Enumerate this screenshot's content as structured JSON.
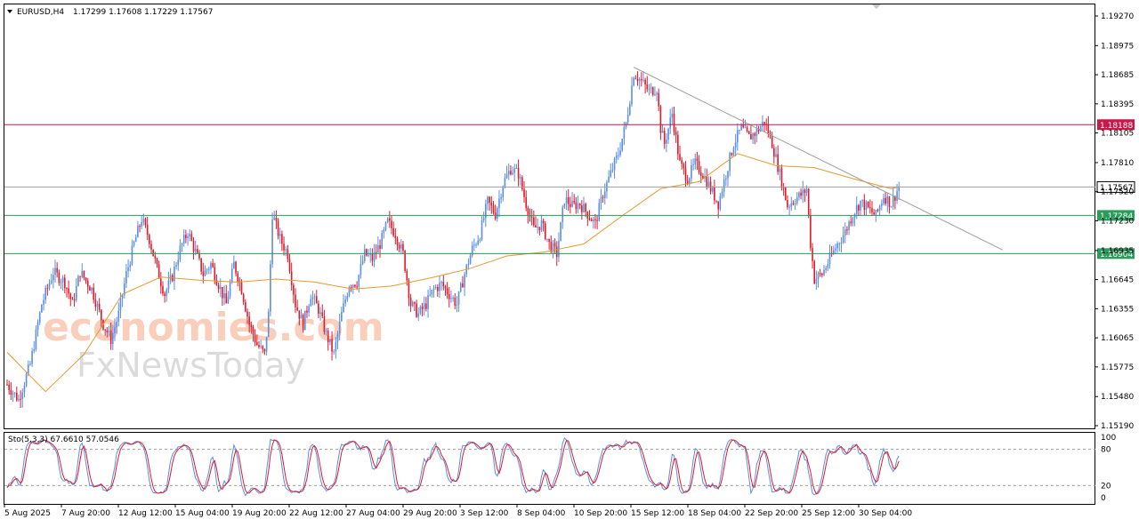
{
  "header": {
    "symbol": "EURUSD,H4",
    "ohlc": "1.17299 1.17608 1.17229 1.17567",
    "collapse_icon": "triangle-down-icon"
  },
  "watermark": {
    "line1": "economies.com",
    "line2": "FxNewsToday"
  },
  "colors": {
    "bull": "#5b8ee6",
    "bear": "#e01a2a",
    "ma": "#e39a2d",
    "resistance": "#c9184a",
    "support": "#2a9d5c",
    "current": "#9e9e9e",
    "trendline": "#9e9e9e",
    "stoch_main": "#5b8ee6",
    "stoch_signal": "#e01a2a"
  },
  "chart_data": [
    {
      "type": "candlestick",
      "symbol": "EURUSD",
      "timeframe": "H4",
      "last": {
        "open": 1.17299,
        "high": 1.17608,
        "low": 1.17229,
        "close": 1.17567
      },
      "ylim": [
        1.1519,
        1.1927
      ],
      "y_ticks": [
        "1.19270",
        "1.18975",
        "1.18685",
        "1.18395",
        "1.18105",
        "1.17810",
        "1.17520",
        "1.17230",
        "1.16935",
        "1.16645",
        "1.16355",
        "1.16065",
        "1.15775",
        "1.15480",
        "1.15190"
      ],
      "x_ticks": [
        "5 Aug 2025",
        "7 Aug 20:00",
        "12 Aug 12:00",
        "15 Aug 04:00",
        "19 Aug 20:00",
        "22 Aug 12:00",
        "27 Aug 04:00",
        "29 Aug 20:00",
        "3 Sep 12:00",
        "8 Sep 04:00",
        "10 Sep 20:00",
        "15 Sep 12:00",
        "18 Sep 04:00",
        "22 Sep 20:00",
        "25 Sep 12:00",
        "30 Sep 04:00"
      ],
      "price_path": [
        [
          0,
          1.156
        ],
        [
          6,
          1.1545
        ],
        [
          12,
          1.158
        ],
        [
          18,
          1.164
        ],
        [
          24,
          1.1672
        ],
        [
          30,
          1.1662
        ],
        [
          34,
          1.164
        ],
        [
          38,
          1.1672
        ],
        [
          44,
          1.1655
        ],
        [
          50,
          1.162
        ],
        [
          54,
          1.1605
        ],
        [
          58,
          1.163
        ],
        [
          62,
          1.167
        ],
        [
          66,
          1.17
        ],
        [
          70,
          1.1725
        ],
        [
          74,
          1.1705
        ],
        [
          78,
          1.1675
        ],
        [
          82,
          1.165
        ],
        [
          86,
          1.1668
        ],
        [
          90,
          1.1695
        ],
        [
          94,
          1.1712
        ],
        [
          98,
          1.1692
        ],
        [
          102,
          1.167
        ],
        [
          106,
          1.168
        ],
        [
          110,
          1.166
        ],
        [
          114,
          1.164
        ],
        [
          118,
          1.168
        ],
        [
          122,
          1.1655
        ],
        [
          126,
          1.162
        ],
        [
          130,
          1.16
        ],
        [
          134,
          1.159
        ],
        [
          136,
          1.163
        ],
        [
          138,
          1.173
        ],
        [
          142,
          1.1705
        ],
        [
          146,
          1.169
        ],
        [
          150,
          1.164
        ],
        [
          154,
          1.162
        ],
        [
          158,
          1.165
        ],
        [
          162,
          1.1635
        ],
        [
          166,
          1.161
        ],
        [
          170,
          1.159
        ],
        [
          174,
          1.163
        ],
        [
          178,
          1.166
        ],
        [
          182,
          1.1662
        ],
        [
          186,
          1.169
        ],
        [
          190,
          1.1685
        ],
        [
          194,
          1.17
        ],
        [
          198,
          1.1722
        ],
        [
          202,
          1.171
        ],
        [
          206,
          1.169
        ],
        [
          210,
          1.164
        ],
        [
          214,
          1.163
        ],
        [
          218,
          1.164
        ],
        [
          222,
          1.1655
        ],
        [
          226,
          1.166
        ],
        [
          230,
          1.165
        ],
        [
          234,
          1.164
        ],
        [
          238,
          1.167
        ],
        [
          242,
          1.1695
        ],
        [
          246,
          1.171
        ],
        [
          250,
          1.1742
        ],
        [
          254,
          1.173
        ],
        [
          258,
          1.176
        ],
        [
          262,
          1.1775
        ],
        [
          266,
          1.177
        ],
        [
          270,
          1.174
        ],
        [
          274,
          1.1715
        ],
        [
          278,
          1.172
        ],
        [
          282,
          1.17
        ],
        [
          286,
          1.169
        ],
        [
          290,
          1.1745
        ],
        [
          294,
          1.1738
        ],
        [
          298,
          1.174
        ],
        [
          302,
          1.173
        ],
        [
          306,
          1.172
        ],
        [
          310,
          1.175
        ],
        [
          314,
          1.177
        ],
        [
          318,
          1.179
        ],
        [
          322,
          1.182
        ],
        [
          326,
          1.187
        ],
        [
          330,
          1.1862
        ],
        [
          334,
          1.1852
        ],
        [
          338,
          1.1855
        ],
        [
          340,
          1.1815
        ],
        [
          342,
          1.18
        ],
        [
          346,
          1.183
        ],
        [
          350,
          1.178
        ],
        [
          354,
          1.1765
        ],
        [
          358,
          1.178
        ],
        [
          362,
          1.177
        ],
        [
          366,
          1.1755
        ],
        [
          370,
          1.174
        ],
        [
          374,
          1.177
        ],
        [
          378,
          1.18
        ],
        [
          382,
          1.1815
        ],
        [
          386,
          1.1806
        ],
        [
          390,
          1.1812
        ],
        [
          394,
          1.1822
        ],
        [
          398,
          1.18
        ],
        [
          402,
          1.177
        ],
        [
          406,
          1.1738
        ],
        [
          410,
          1.1745
        ],
        [
          414,
          1.175
        ],
        [
          416,
          1.1755
        ],
        [
          418,
          1.17
        ],
        [
          420,
          1.1665
        ],
        [
          424,
          1.167
        ],
        [
          428,
          1.1685
        ],
        [
          432,
          1.17
        ],
        [
          436,
          1.1712
        ],
        [
          440,
          1.173
        ],
        [
          444,
          1.1742
        ],
        [
          448,
          1.1735
        ],
        [
          452,
          1.1728
        ],
        [
          456,
          1.1748
        ],
        [
          460,
          1.174
        ],
        [
          464,
          1.1757
        ]
      ],
      "series": [
        {
          "name": "",
          "kind": "moving-average",
          "x": [
            0,
            20,
            40,
            60,
            80,
            100,
            120,
            140,
            160,
            180,
            200,
            220,
            240,
            260,
            280,
            300,
            320,
            340,
            360,
            380,
            400,
            420,
            440,
            460,
            464
          ],
          "y": [
            1.1592,
            1.1553,
            1.159,
            1.165,
            1.1667,
            1.1664,
            1.1662,
            1.1665,
            1.1662,
            1.1655,
            1.1658,
            1.1666,
            1.1675,
            1.1688,
            1.1692,
            1.17,
            1.1728,
            1.1755,
            1.1762,
            1.179,
            1.1778,
            1.1776,
            1.1765,
            1.1755,
            1.1757
          ]
        }
      ],
      "levels": [
        {
          "label": "1.18188",
          "value": 1.18188,
          "role": "resistance"
        },
        {
          "label": "1.17567",
          "value": 1.17567,
          "role": "current"
        },
        {
          "label": "1.17284",
          "value": 1.17284,
          "role": "support"
        },
        {
          "label": "1.16904",
          "value": 1.16904,
          "role": "support"
        }
      ],
      "trendline": {
        "x": [
          326,
          518
        ],
        "y": [
          1.1876,
          1.1694
        ]
      },
      "grid": false
    },
    {
      "type": "line",
      "name": "Sto(5,3,3) 67.6610 57.0546",
      "indicator_label": "Sto(5,3,3)",
      "main_value": "67.6610",
      "signal_value": "57.0546",
      "ylim": [
        0,
        100
      ],
      "y_ticks": [
        "100",
        "80",
        "20",
        "0"
      ],
      "levels": [
        80,
        20
      ],
      "series": [
        {
          "name": "",
          "role": "main",
          "period": 5
        },
        {
          "name": "",
          "role": "signal",
          "period": 3
        }
      ]
    }
  ]
}
